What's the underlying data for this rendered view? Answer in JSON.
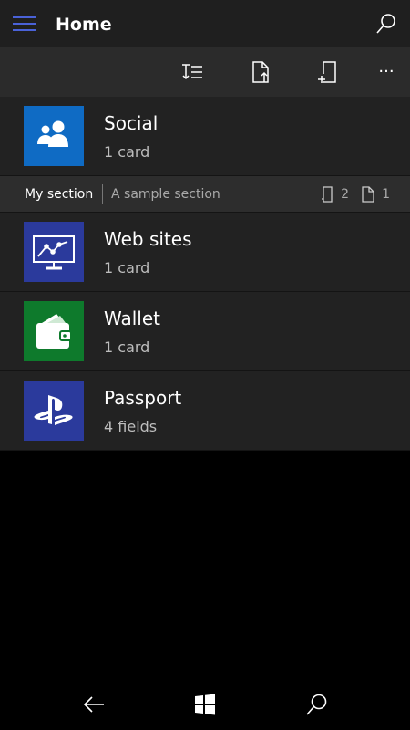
{
  "header": {
    "title": "Home"
  },
  "command_bar": {
    "icons": [
      "sort-icon",
      "export-file-icon",
      "add-card-icon",
      "more-icon"
    ],
    "more_glyph": "···"
  },
  "items": {
    "social": {
      "title": "Social",
      "subtitle": "1 card",
      "color": "#0f6bc4",
      "icon": "people-icon"
    },
    "web_sites": {
      "title": "Web sites",
      "subtitle": "1 card",
      "color": "#2b3a9c",
      "icon": "monitor-chart-icon"
    },
    "wallet": {
      "title": "Wallet",
      "subtitle": "1 card",
      "color": "#0e7a2c",
      "icon": "wallet-icon"
    },
    "passport": {
      "title": "Passport",
      "subtitle": "4 fields",
      "color": "#2b3a9c",
      "icon": "playstation-icon"
    }
  },
  "section": {
    "name": "My section",
    "description": "A sample section",
    "card_count": "2",
    "item_count": "1"
  },
  "nav": {
    "icons": [
      "back-arrow-icon",
      "windows-icon",
      "search-icon"
    ]
  }
}
